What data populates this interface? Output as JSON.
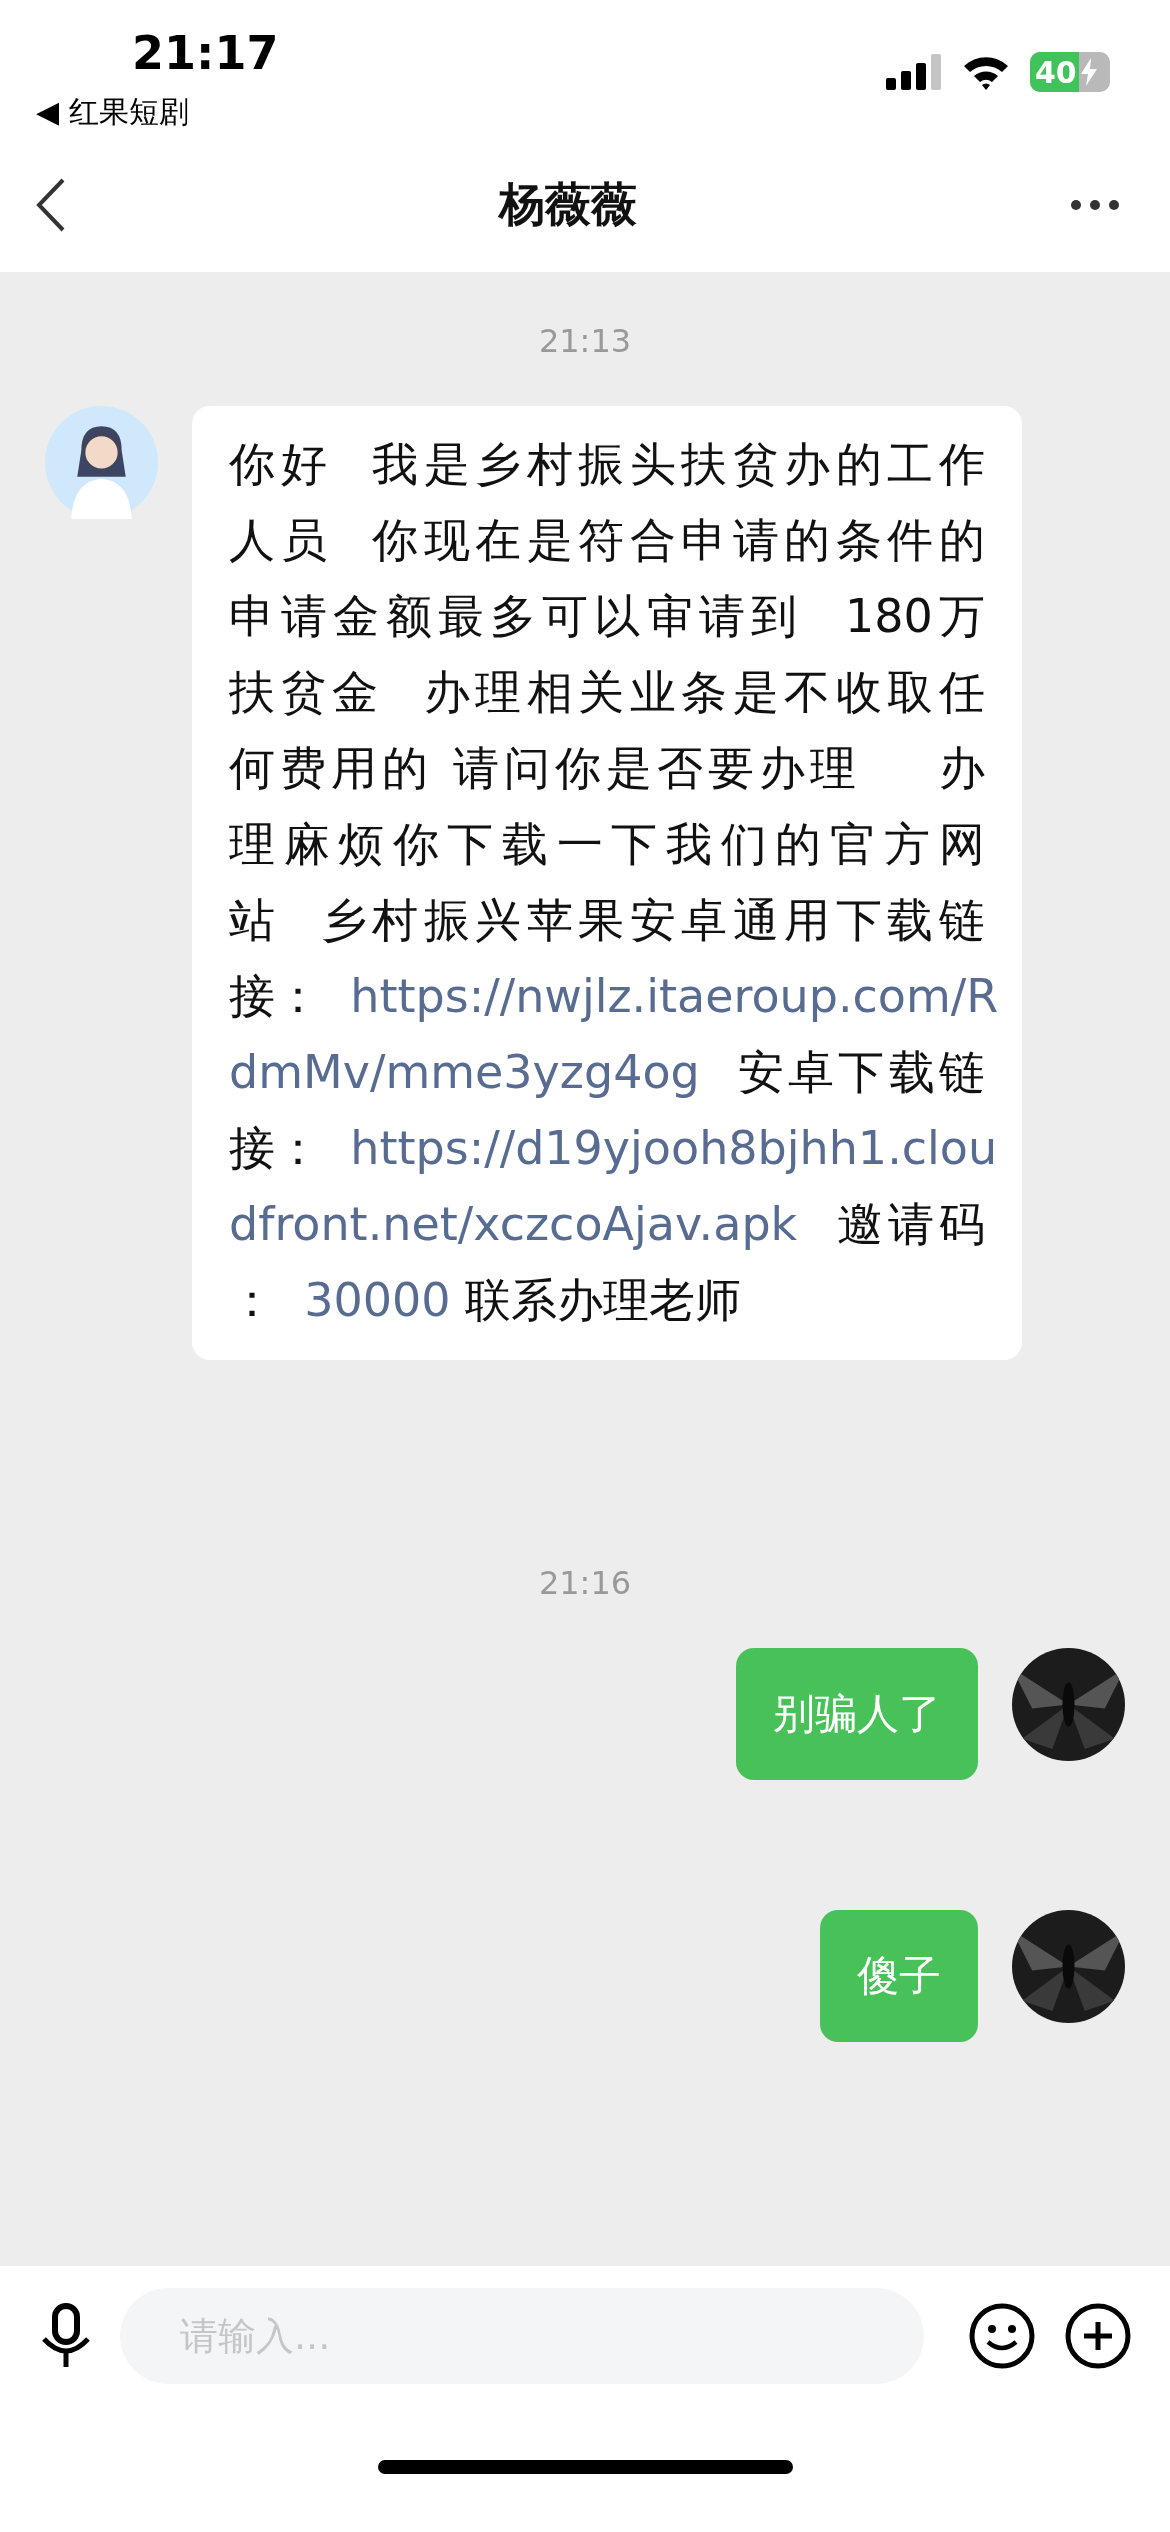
{
  "status_bar": {
    "time": "21:17",
    "back_app": "◀ 红果短剧",
    "battery": "40"
  },
  "nav": {
    "title": "杨薇薇"
  },
  "messages": [
    {
      "kind": "time",
      "text": "21:13"
    },
    {
      "kind": "incoming",
      "lines": [
        [
          {
            "kind": "text",
            "text": "你好  我是乡村振头扶贫办的工作"
          }
        ],
        [
          {
            "kind": "text",
            "text": "人员  你现在是符合申请的条件的"
          }
        ],
        [
          {
            "kind": "text",
            "text": "申请金额最多可以审请到  180万"
          }
        ],
        [
          {
            "kind": "text",
            "text": "扶贫金  办理相关业条是不收取任"
          }
        ],
        [
          {
            "kind": "text",
            "text": "何费用的 请问你是否要办理    办"
          }
        ],
        [
          {
            "kind": "text",
            "text": "理麻烦你下载一下我们的官方网"
          }
        ],
        [
          {
            "kind": "text",
            "text": "站  乡村振兴苹果安卓通用下载链"
          }
        ],
        [
          {
            "kind": "text",
            "text": "接：  "
          },
          {
            "kind": "link",
            "text": "https://nwjlz.itaeroup.com/R"
          }
        ],
        [
          {
            "kind": "link",
            "text": "dmMv/mme3yzg4og"
          },
          {
            "kind": "text",
            "text": "  安卓下载链"
          }
        ],
        [
          {
            "kind": "text",
            "text": "接：  "
          },
          {
            "kind": "link",
            "text": "https://d19yjooh8bjhh1.clou"
          }
        ],
        [
          {
            "kind": "link",
            "text": "dfront.net/xczcoAjav.apk"
          },
          {
            "kind": "text",
            "text": "  邀请码"
          }
        ],
        [
          {
            "kind": "text",
            "text": "：  "
          },
          {
            "kind": "link",
            "text": "30000"
          },
          {
            "kind": "text",
            "text": " 联系办理老师"
          }
        ]
      ]
    },
    {
      "kind": "time",
      "text": "21:16"
    },
    {
      "kind": "outgoing",
      "text": "别骗人了"
    },
    {
      "kind": "outgoing",
      "text": "傻子"
    }
  ],
  "input": {
    "placeholder": "请输入..."
  }
}
